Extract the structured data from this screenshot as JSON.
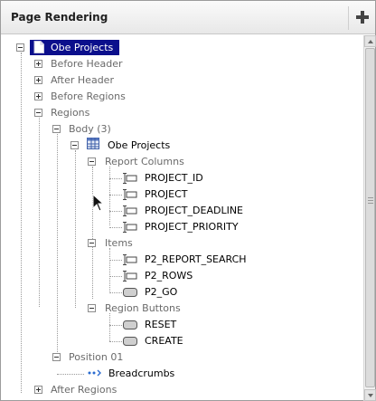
{
  "panel": {
    "title": "Page Rendering",
    "add_icon": "plus-icon"
  },
  "tree": {
    "root": "Obe Projects",
    "before_header": "Before Header",
    "after_header": "After Header",
    "before_regions": "Before Regions",
    "regions": "Regions",
    "body": "Body (3)",
    "region_obe_projects": "Obe Projects",
    "report_columns": "Report Columns",
    "columns": [
      "PROJECT_ID",
      "PROJECT",
      "PROJECT_DEADLINE",
      "PROJECT_PRIORITY"
    ],
    "items_group": "Items",
    "items": [
      "P2_REPORT_SEARCH",
      "P2_ROWS",
      "P2_GO"
    ],
    "region_buttons": "Region Buttons",
    "buttons": [
      "RESET",
      "CREATE"
    ],
    "position": "Position 01",
    "breadcrumbs": "Breadcrumbs",
    "after_regions": "After Regions"
  },
  "colors": {
    "selection": "#0b0f8c",
    "group_text": "#6a6a6a"
  }
}
